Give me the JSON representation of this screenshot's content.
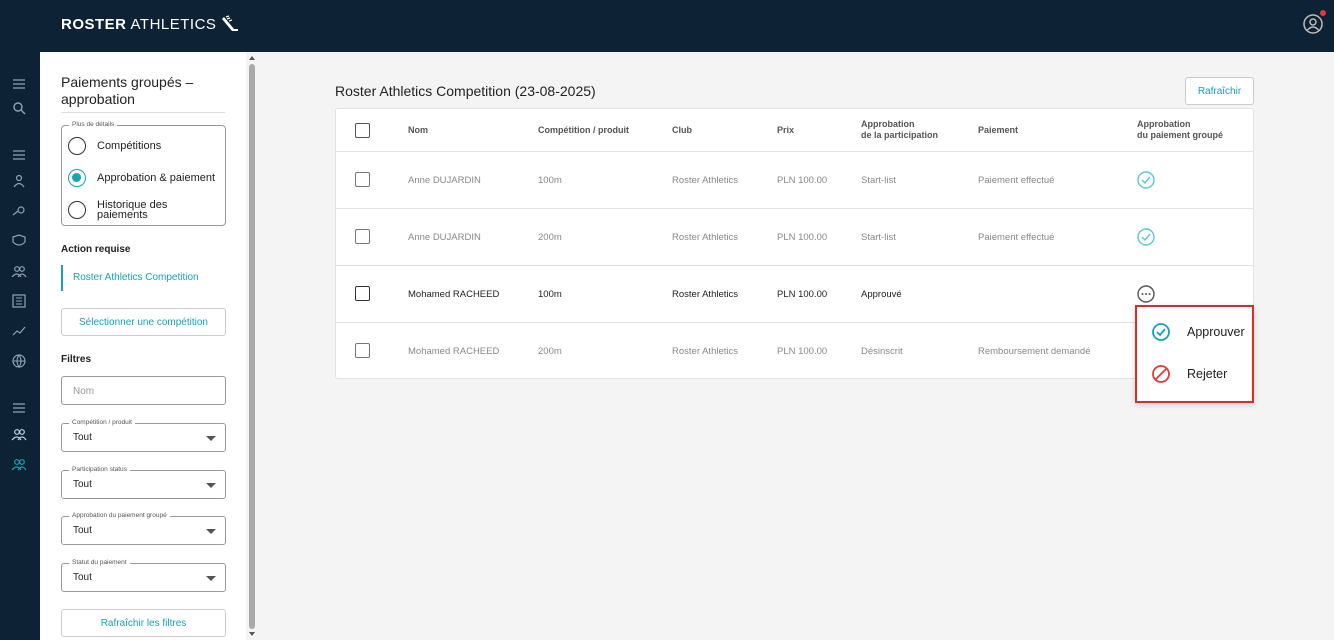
{
  "app": {
    "brand_bold": "ROSTER",
    "brand_light": "ATHLETICS"
  },
  "colors": {
    "accent": "#17a2b8",
    "navy": "#0e2236",
    "danger": "#d32f2f"
  },
  "panel": {
    "title": "Paiements groupés – approbation",
    "details_legend": "Plus de détails",
    "options": [
      {
        "label": "Compétitions",
        "selected": false
      },
      {
        "label": "Approbation & paiement",
        "selected": true
      },
      {
        "label": "Historique des paiements",
        "selected": false
      }
    ],
    "action_heading": "Action requise",
    "competition_link": "Roster Athletics Competition",
    "select_competition": "Sélectionner une compétition",
    "filters_heading": "Filtres",
    "name_placeholder": "Nom",
    "filters": [
      {
        "label": "Compétition / produit",
        "value": "Tout"
      },
      {
        "label": "Participation status",
        "value": "Tout"
      },
      {
        "label": "Approbation du paiement groupé",
        "value": "Tout"
      },
      {
        "label": "Statut du paiement",
        "value": "Tout"
      }
    ],
    "refresh_filters": "Rafraîchir les filtres"
  },
  "main": {
    "title": "Roster Athletics Competition (23-08-2025)",
    "refresh": "Rafraîchir",
    "columns": {
      "name": "Nom",
      "competition": "Compétition / produit",
      "club": "Club",
      "price": "Prix",
      "participation_1": "Approbation",
      "participation_2": "de la participation",
      "payment": "Paiement",
      "group_1": "Approbation",
      "group_2": "du paiement groupé"
    },
    "rows": [
      {
        "name": "Anne DUJARDIN",
        "competition": "100m",
        "club": "Roster Athletics",
        "price": "PLN 100.00",
        "participation": "Start-list",
        "payment": "Paiement effectué",
        "status_icon": "check-circle-icon"
      },
      {
        "name": "Anne DUJARDIN",
        "competition": "200m",
        "club": "Roster Athletics",
        "price": "PLN 100.00",
        "participation": "Start-list",
        "payment": "Paiement effectué",
        "status_icon": "check-circle-icon"
      },
      {
        "name": "Mohamed RACHEED",
        "competition": "100m",
        "club": "Roster Athletics",
        "price": "PLN 100.00",
        "participation": "Approuvé",
        "payment": "",
        "status_icon": "more-options-icon"
      },
      {
        "name": "Mohamed RACHEED",
        "competition": "200m",
        "club": "Roster Athletics",
        "price": "PLN 100.00",
        "participation": "Désinscrit",
        "payment": "Remboursement demandé",
        "status_icon": ""
      }
    ]
  },
  "menu": {
    "approve": "Approuver",
    "reject": "Rejeter"
  }
}
